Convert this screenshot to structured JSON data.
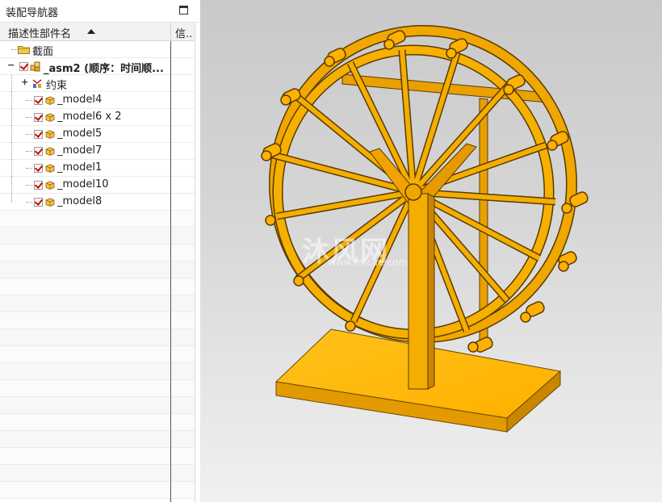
{
  "navigator": {
    "title": "装配导航器",
    "columns": {
      "name": "描述性部件名",
      "info": "信.."
    },
    "tree": [
      {
        "label": "截面",
        "type": "folder"
      },
      {
        "label": "_asm2 (顺序：时间顺...",
        "type": "assembly",
        "checked": true,
        "expanded": true
      },
      {
        "label": "约束",
        "type": "constraints",
        "expanded": false
      },
      {
        "label": "_model4",
        "type": "part",
        "checked": true
      },
      {
        "label": "_model6 x 2",
        "type": "part",
        "checked": true
      },
      {
        "label": "_model5",
        "type": "part",
        "checked": true
      },
      {
        "label": "_model7",
        "type": "part",
        "checked": true
      },
      {
        "label": "_model1",
        "type": "part",
        "checked": true
      },
      {
        "label": "_model10",
        "type": "part",
        "checked": true
      },
      {
        "label": "_model8",
        "type": "part",
        "checked": true
      }
    ],
    "expander_collapsed": "+",
    "expander_expanded": "−"
  },
  "viewport": {
    "watermark_main": "沐风网",
    "watermark_sub": "www.mfcad.com",
    "model_color": "#ffb400",
    "model_edge_color": "#5a3a00"
  },
  "icons": {
    "folder": "folder-icon",
    "assembly": "assembly-icon",
    "constraints": "constraints-icon",
    "part": "part-icon",
    "checkbox": "checkbox-icon",
    "sort": "sort-ascending-icon",
    "maximize": "maximize-icon"
  }
}
